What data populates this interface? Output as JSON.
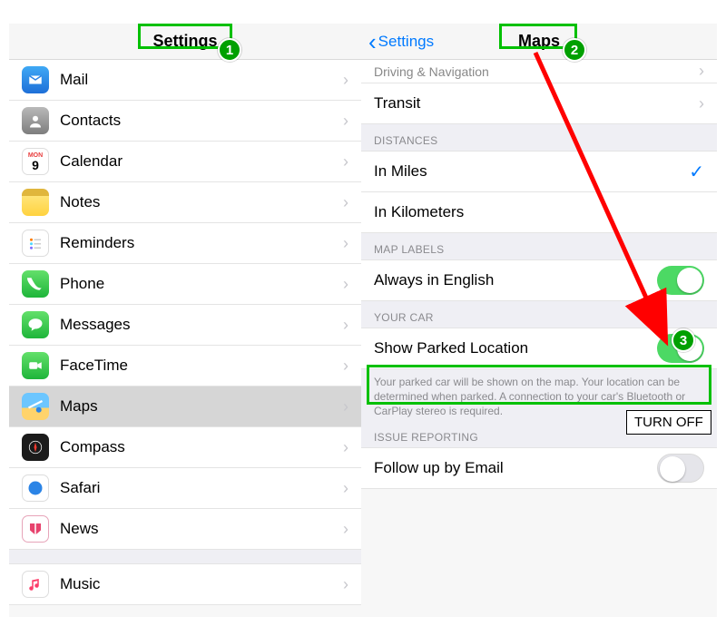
{
  "annotations": {
    "step1": "1",
    "step2": "2",
    "step3": "3",
    "turn_off_label": "TURN OFF"
  },
  "left": {
    "title": "Settings",
    "items": [
      {
        "icon": "mail-icon",
        "label": "Mail"
      },
      {
        "icon": "contacts-icon",
        "label": "Contacts"
      },
      {
        "icon": "calendar-icon",
        "label": "Calendar"
      },
      {
        "icon": "notes-icon",
        "label": "Notes"
      },
      {
        "icon": "reminders-icon",
        "label": "Reminders"
      },
      {
        "icon": "phone-icon",
        "label": "Phone"
      },
      {
        "icon": "messages-icon",
        "label": "Messages"
      },
      {
        "icon": "facetime-icon",
        "label": "FaceTime"
      },
      {
        "icon": "maps-icon",
        "label": "Maps"
      },
      {
        "icon": "compass-icon",
        "label": "Compass"
      },
      {
        "icon": "safari-icon",
        "label": "Safari"
      },
      {
        "icon": "news-icon",
        "label": "News"
      },
      {
        "icon": "music-icon",
        "label": "Music"
      }
    ],
    "selected_index": 8
  },
  "right": {
    "back_label": "Settings",
    "title": "Maps",
    "nav_scrolled": {
      "row0": "Driving & Navigation",
      "row1": "Transit"
    },
    "sections": {
      "distances": {
        "header": "DISTANCES",
        "miles": "In Miles",
        "kilometers": "In Kilometers",
        "selected": "miles"
      },
      "map_labels": {
        "header": "MAP LABELS",
        "english_label": "Always in English",
        "english_on": true
      },
      "your_car": {
        "header": "YOUR CAR",
        "show_parked": "Show Parked Location",
        "show_parked_on": true,
        "note": "Your parked car will be shown on the map. Your location can be determined when parked. A connection to your car's Bluetooth or CarPlay stereo is required."
      },
      "issue": {
        "header": "ISSUE REPORTING",
        "follow_up": "Follow up by Email",
        "follow_up_on": false
      }
    }
  }
}
